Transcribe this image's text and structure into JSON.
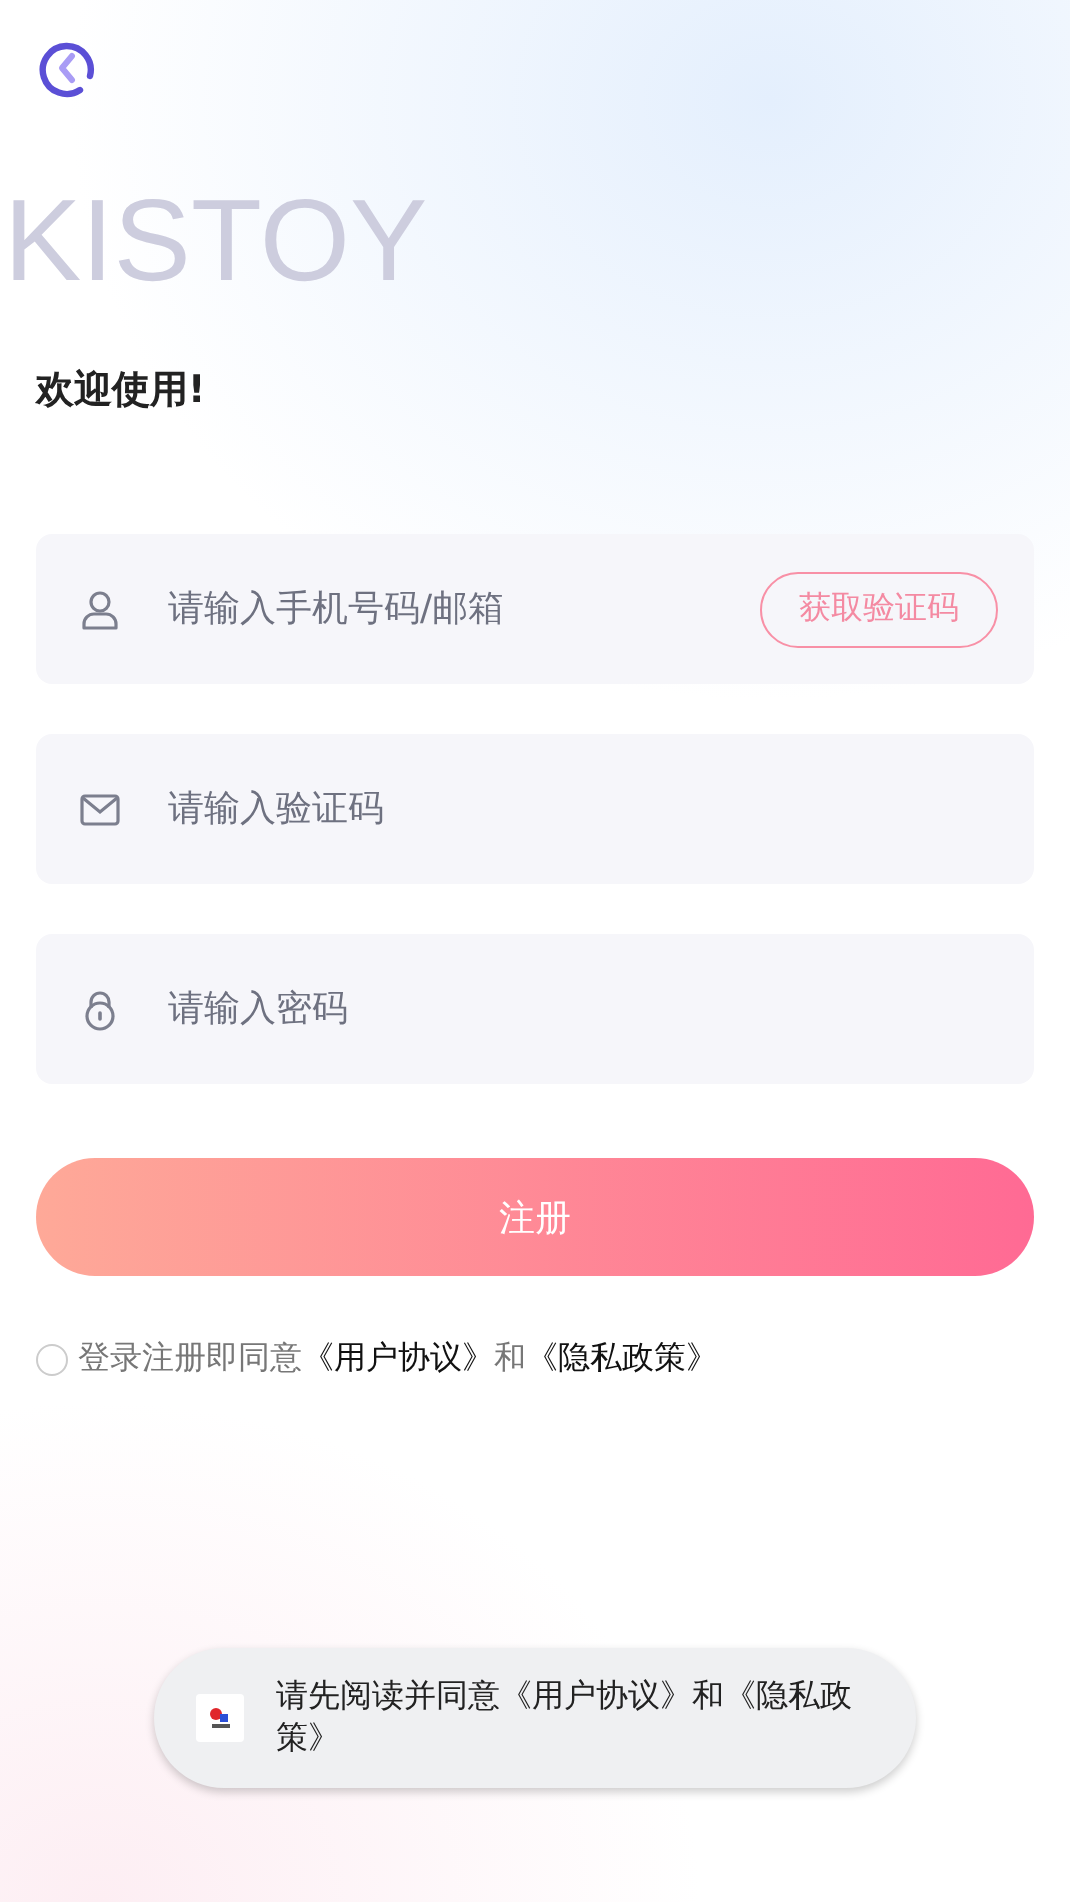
{
  "watermark": "KISTOY",
  "greeting": "欢迎使用!",
  "fields": [
    {
      "kind": "account",
      "placeholder": "请输入手机号码/邮箱",
      "action": "获取验证码"
    },
    {
      "kind": "code",
      "placeholder": "请输入验证码"
    },
    {
      "kind": "password",
      "placeholder": "请输入密码"
    }
  ],
  "submit": "注册",
  "agreement": {
    "checked": false,
    "prefix": "登录注册即同意",
    "link_1": "《用户协议》",
    "joiner": "和",
    "link_2": "《隐私政策》"
  },
  "toast": {
    "text": "请先阅读并同意《用户协议》和《隐私政策》"
  }
}
